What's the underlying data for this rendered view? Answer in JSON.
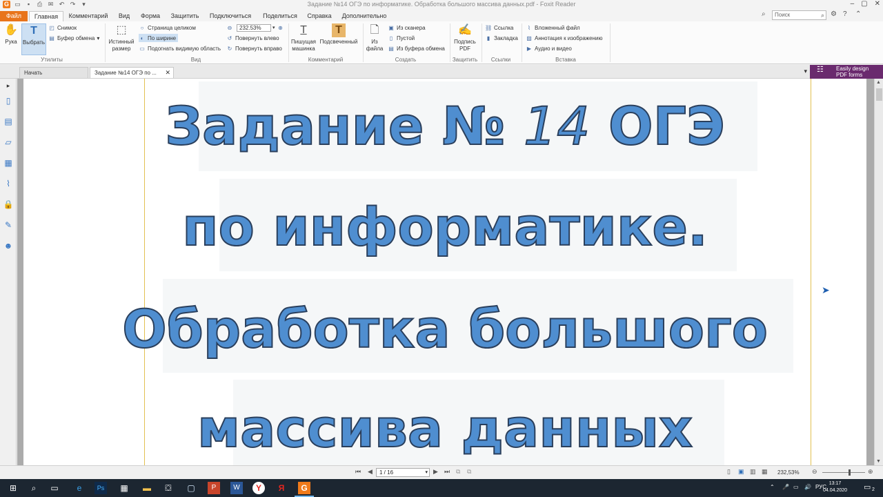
{
  "window": {
    "title": "Задание №14 ОГЭ по информатике. Обработка большого массива данных.pdf - Foxit Reader"
  },
  "ribbon_tabs": [
    "Файл",
    "Главная",
    "Комментарий",
    "Вид",
    "Форма",
    "Защитить",
    "Подключиться",
    "Поделиться",
    "Справка",
    "Дополнительно"
  ],
  "search": {
    "placeholder": "Поиск"
  },
  "ribbon": {
    "hand": "Рука",
    "select": "Выбрать",
    "snapshot": "Снимок",
    "clipboard": "Буфер обмена",
    "utilities": "Утилиты",
    "actual_size_1": "Истинный",
    "actual_size_2": "размер",
    "whole_page": "Страница целиком",
    "fit_width": "По ширине",
    "fit_visible": "Подогнать видимую область",
    "zoom": "232.53%",
    "rotate_left": "Повернуть влево",
    "rotate_right": "Повернуть вправо",
    "view": "Вид",
    "typewriter_1": "Пишущая",
    "typewriter_2": "машинка",
    "highlight": "Подсвеченный",
    "comment": "Комментарий",
    "from_file_1": "Из",
    "from_file_2": "файла",
    "from_scanner": "Из сканера",
    "blank": "Пустой",
    "from_clipboard": "Из буфера обмена",
    "create": "Создать",
    "sign_1": "Подпись",
    "sign_2": "PDF",
    "protect": "Защитить",
    "link": "Ссылка",
    "bookmark": "Закладка",
    "links": "Ссылки",
    "attached_file": "Вложенный файл",
    "image_annotation": "Аннотация к изображению",
    "audio_video": "Аудио и видео",
    "insert": "Вставка"
  },
  "doc_tabs": [
    {
      "label": "Начать"
    },
    {
      "label": "Задание №14 ОГЭ по ..."
    }
  ],
  "ad": {
    "line1": "Easily design",
    "line2": "PDF forms"
  },
  "page": {
    "line1_a": "Задание №",
    "line1_b": "14",
    "line1_c": "ОГЭ",
    "line2": "по информатике.",
    "line3": "Обработка большого",
    "line4": "массива данных"
  },
  "status": {
    "page": "1 / 16",
    "zoom": "232,53%"
  },
  "taskbar": {
    "lang": "РУС",
    "time": "13:17",
    "date": "04.04.2020",
    "notif": "2"
  }
}
